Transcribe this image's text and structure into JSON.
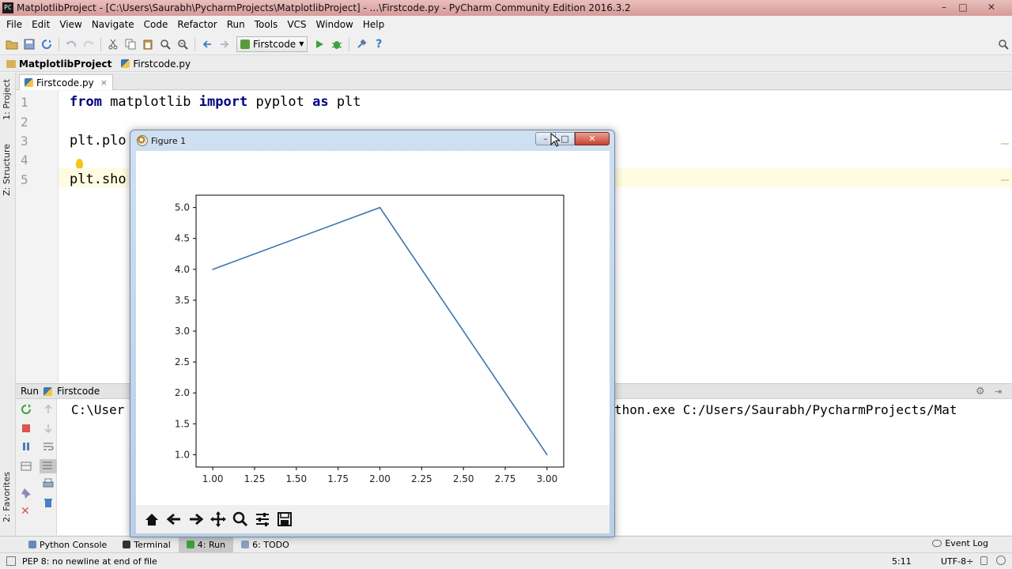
{
  "window": {
    "title": "MatplotlibProject - [C:\\Users\\Saurabh\\PycharmProjects\\MatplotlibProject] - ...\\Firstcode.py - PyCharm Community Edition 2016.3.2",
    "app_icon": "PC",
    "minimize": "–",
    "maximize": "□",
    "close": "✕"
  },
  "menu": [
    "File",
    "Edit",
    "View",
    "Navigate",
    "Code",
    "Refactor",
    "Run",
    "Tools",
    "VCS",
    "Window",
    "Help"
  ],
  "toolbar": {
    "run_config": "Firstcode",
    "help": "?"
  },
  "breadcrumb": {
    "project": "MatplotlibProject",
    "file": "Firstcode.py"
  },
  "left_strip": {
    "project_tab": "1: Project",
    "structure_tab": "Z: Structure",
    "favorites_tab": "2: Favorites"
  },
  "editor": {
    "tab_label": "Firstcode.py",
    "tab_close": "×",
    "line_numbers": [
      "1",
      "2",
      "3",
      "4",
      "5"
    ],
    "line1_kw1": "from",
    "line1_mid": " matplotlib ",
    "line1_kw2": "import",
    "line1_mid2": " pyplot ",
    "line1_kw3": "as",
    "line1_end": " plt",
    "line3": "plt.plo",
    "line5": "plt.sho"
  },
  "run_panel": {
    "header": "Run",
    "config": "Firstcode",
    "console_left": "C:\\User",
    "console_right": "thon.exe C:/Users/Saurabh/PycharmProjects/Mat"
  },
  "bottom_tabs": [
    {
      "label": "Python Console",
      "active": false
    },
    {
      "label": "Terminal",
      "active": false
    },
    {
      "label": "4: Run",
      "active": true
    },
    {
      "label": "6: TODO",
      "active": false
    }
  ],
  "event_log": "Event Log",
  "status": {
    "message": "PEP 8: no newline at end of file",
    "position": "5:11",
    "encoding": "UTF-8÷"
  },
  "figure": {
    "title": "Figure 1",
    "min": "–",
    "max": "□",
    "close": "✕"
  },
  "chart_data": {
    "type": "line",
    "x": [
      1.0,
      2.0,
      3.0
    ],
    "series": [
      {
        "values": [
          4.0,
          5.0,
          1.0
        ],
        "color": "#3b75af"
      }
    ],
    "xlim": [
      0.9,
      3.1
    ],
    "ylim": [
      0.8,
      5.2
    ],
    "xticks": [
      "1.00",
      "1.25",
      "1.50",
      "1.75",
      "2.00",
      "2.25",
      "2.50",
      "2.75",
      "3.00"
    ],
    "yticks": [
      "1.0",
      "1.5",
      "2.0",
      "2.5",
      "3.0",
      "3.5",
      "4.0",
      "4.5",
      "5.0"
    ],
    "grid": false
  }
}
